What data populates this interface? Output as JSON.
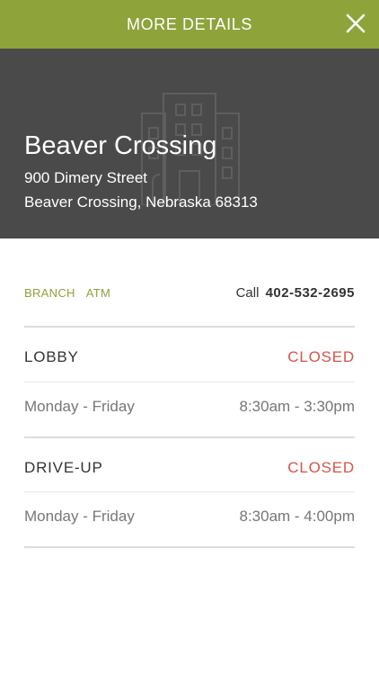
{
  "header": {
    "title": "MORE DETAILS"
  },
  "location": {
    "name": "Beaver Crossing",
    "address_line1": "900 Dimery Street",
    "address_line2": "Beaver Crossing, Nebraska 68313"
  },
  "tags": [
    "BRANCH",
    "ATM"
  ],
  "call": {
    "label": "Call",
    "phone": "402-532-2695"
  },
  "sections": [
    {
      "title": "LOBBY",
      "status": "CLOSED",
      "days": "Monday - Friday",
      "hours": "8:30am - 3:30pm"
    },
    {
      "title": "DRIVE-UP",
      "status": "CLOSED",
      "days": "Monday - Friday",
      "hours": "8:30am - 4:00pm"
    }
  ],
  "colors": {
    "accent": "#8ea33a",
    "hero_bg": "#4a4a4a",
    "closed": "#d2554a"
  },
  "icons": {
    "close": "close-icon",
    "background": "building-icon"
  }
}
